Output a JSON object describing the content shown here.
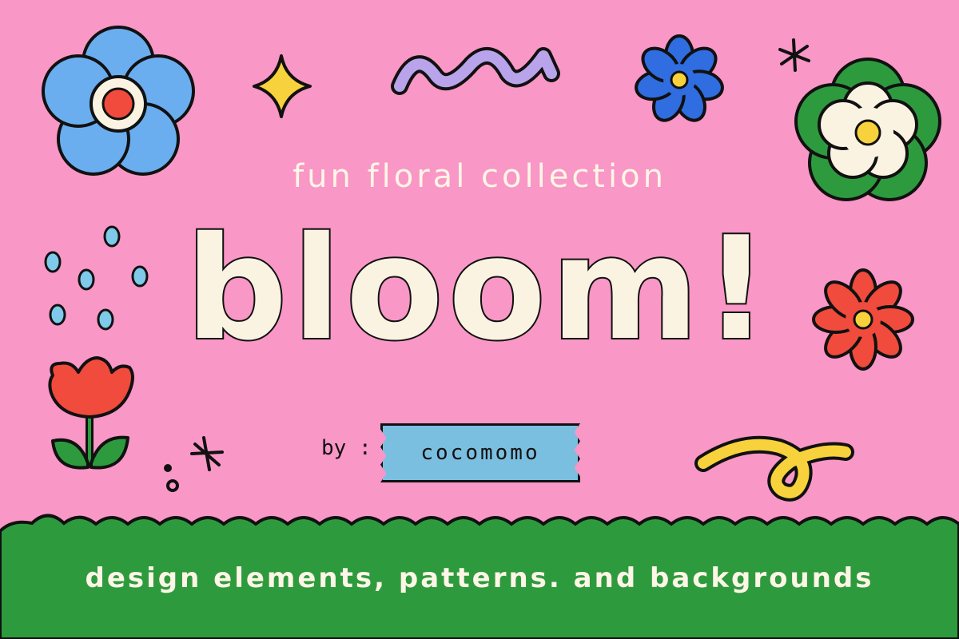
{
  "subtitle": "fun floral collection",
  "title": "bloom!",
  "byline": {
    "prefix": "by :",
    "author": "cocomomo"
  },
  "footer": "design elements, patterns. and backgrounds",
  "colors": {
    "background": "#f997c6",
    "ground": "#2e9a3e",
    "cream": "#fbf3e2",
    "outline": "#111111",
    "blue": "#6aaef0",
    "red": "#f04b3c",
    "yellow": "#f8d23c",
    "lavender": "#b9a3ea",
    "tape": "#7bbfe0"
  },
  "icons": [
    "blue-flower-icon",
    "sparkle-icon",
    "squiggle-icon",
    "small-blue-flower-icon",
    "asterisk-icon",
    "white-flower-icon",
    "raindrops-icon",
    "red-flower-icon",
    "tulip-icon",
    "asterisk-small-icon",
    "curl-icon"
  ]
}
